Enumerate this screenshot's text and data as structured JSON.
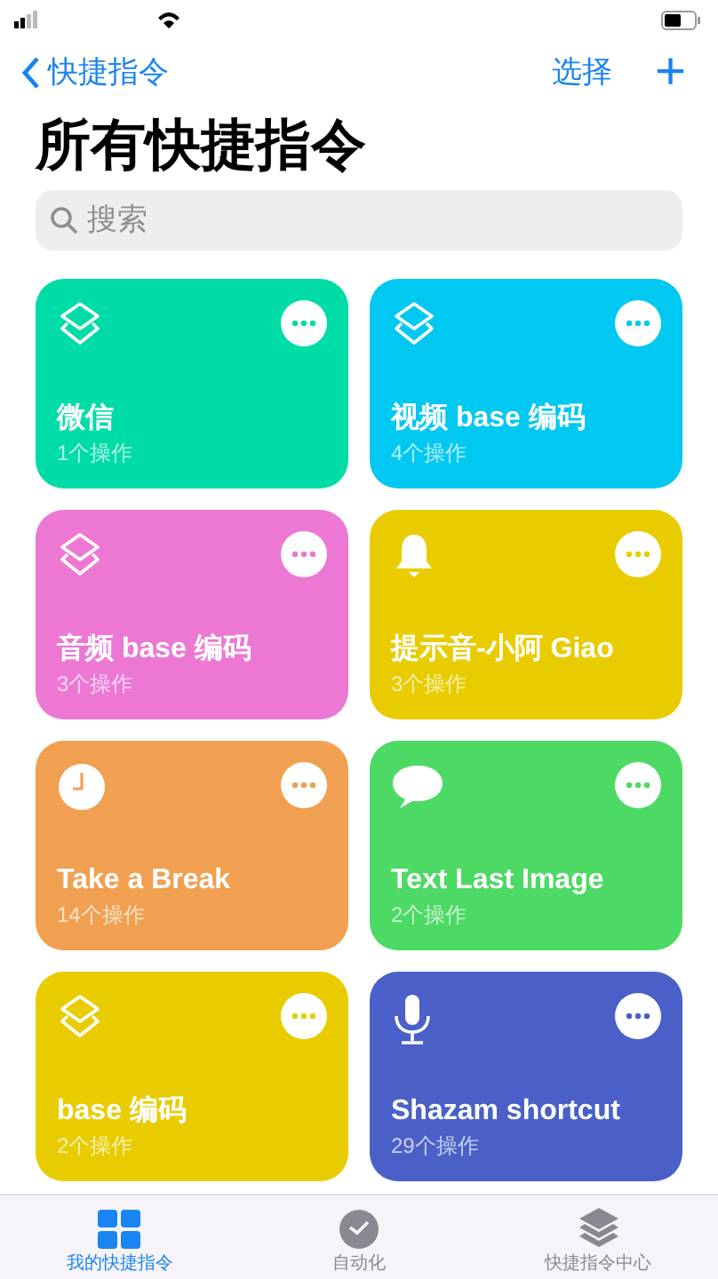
{
  "nav": {
    "back": "快捷指令",
    "action": "选择",
    "add": "+"
  },
  "title": "所有快捷指令",
  "search": {
    "placeholder": "搜索"
  },
  "shortcuts": [
    {
      "name": "微信",
      "count": "1个操作",
      "color": "#00dca8",
      "kind": "layers"
    },
    {
      "name": "视频 base 编码",
      "count": "4个操作",
      "color": "#00c8f0",
      "kind": "layers"
    },
    {
      "name": "音频 base 编码",
      "count": "3个操作",
      "color": "#ec78d4",
      "kind": "layers"
    },
    {
      "name": "提示音-小阿 Giao",
      "count": "3个操作",
      "color": "#e8cc00",
      "kind": "bell"
    },
    {
      "name": "Take a Break",
      "count": "14个操作",
      "color": "#f0a050",
      "kind": "clock"
    },
    {
      "name": "Text Last Image",
      "count": "2个操作",
      "color": "#4cd964",
      "kind": "bubble"
    },
    {
      "name": "base 编码",
      "count": "2个操作",
      "color": "#e8cc00",
      "kind": "layers"
    },
    {
      "name": "Shazam shortcut",
      "count": "29个操作",
      "color": "#4a60c8",
      "kind": "mic"
    }
  ],
  "tabs": [
    {
      "label": "我的快捷指令",
      "kind": "grid",
      "selected": true
    },
    {
      "label": "自动化",
      "kind": "check",
      "selected": false
    },
    {
      "label": "快捷指令中心",
      "kind": "layers",
      "selected": false
    }
  ]
}
